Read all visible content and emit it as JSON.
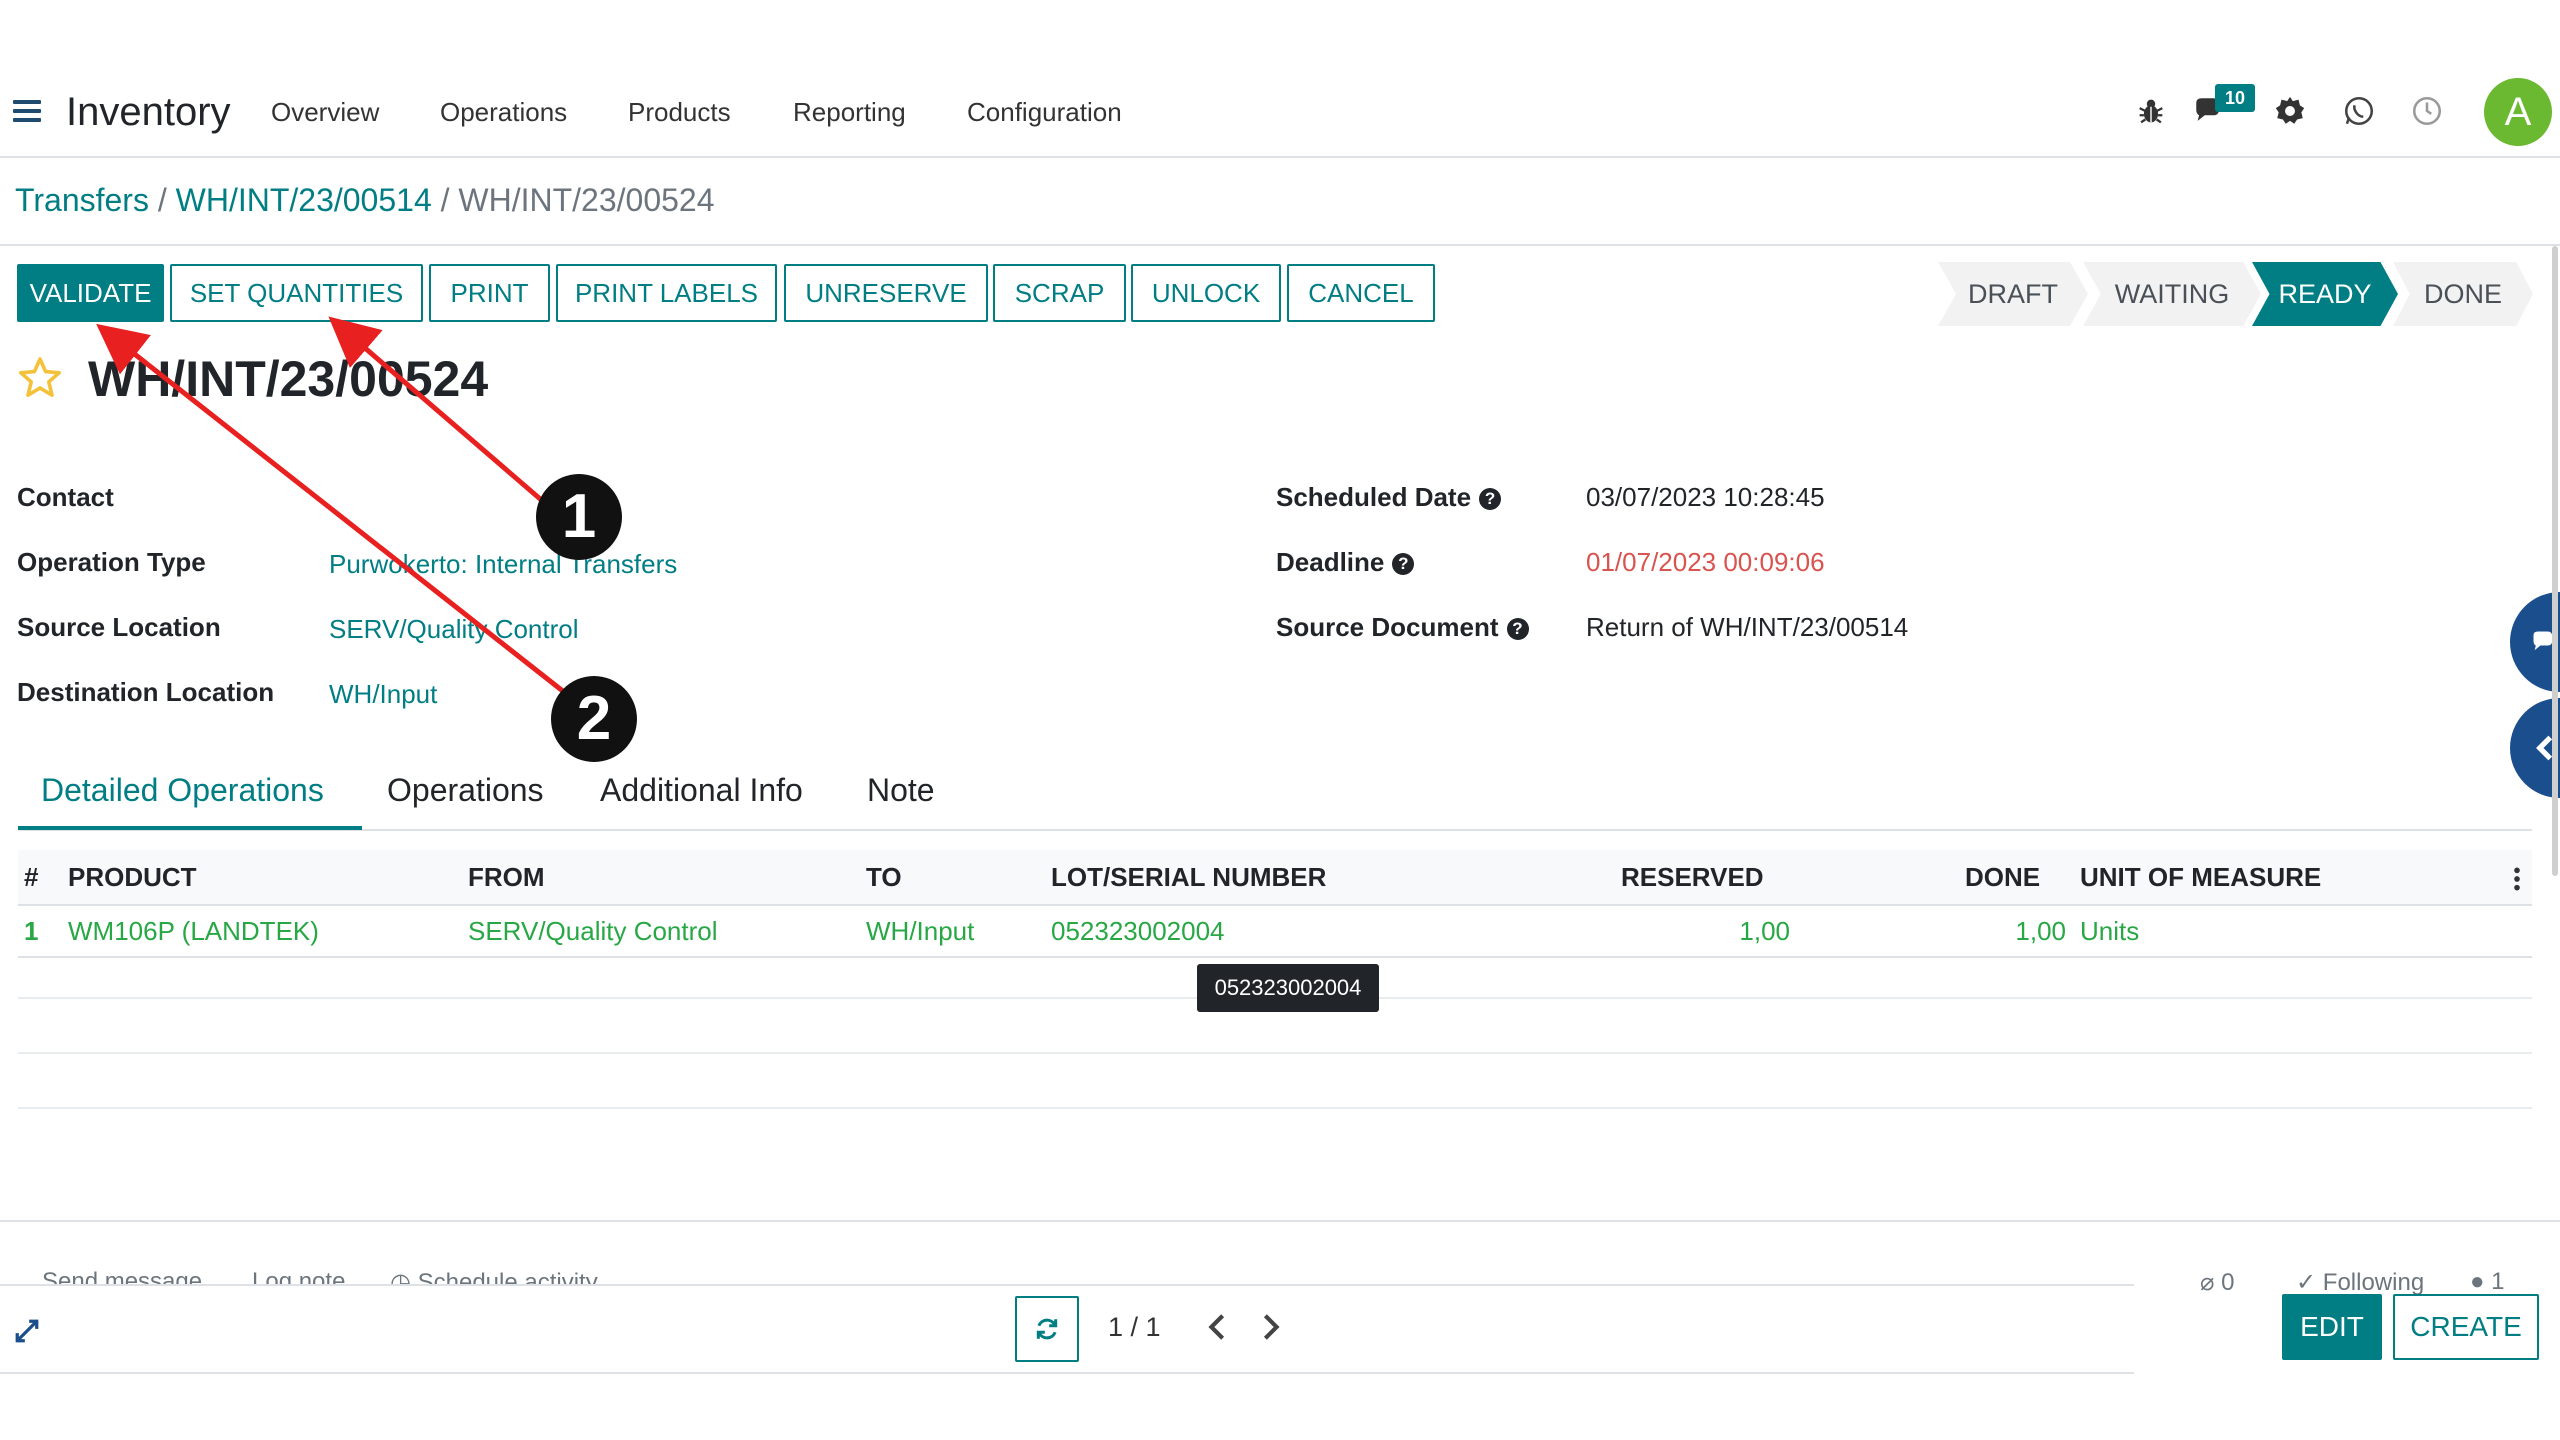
{
  "navbar": {
    "app_name": "Inventory",
    "menu": [
      "Overview",
      "Operations",
      "Products",
      "Reporting",
      "Configuration"
    ],
    "messages_badge": "10",
    "avatar_letter": "A",
    "systray_icons": [
      "bug-icon",
      "chat-icon",
      "gear-icon",
      "whatsapp-icon",
      "clock-icon"
    ]
  },
  "breadcrumb": {
    "parent": "Transfers",
    "middle": "WH/INT/23/00514",
    "current": "WH/INT/23/00524",
    "separator": "/"
  },
  "actions": {
    "validate": "VALIDATE",
    "set_quantities": "SET QUANTITIES",
    "print": "PRINT",
    "print_labels": "PRINT LABELS",
    "unreserve": "UNRESERVE",
    "scrap": "SCRAP",
    "unlock": "UNLOCK",
    "cancel": "CANCEL"
  },
  "status": {
    "stages": [
      "DRAFT",
      "WAITING",
      "READY",
      "DONE"
    ],
    "active": "READY"
  },
  "record": {
    "title": "WH/INT/23/00524"
  },
  "fields": {
    "contact_label": "Contact",
    "contact_value": "",
    "operation_type_label": "Operation Type",
    "operation_type_value": "Purwokerto: Internal Transfers",
    "source_location_label": "Source Location",
    "source_location_value": "SERV/Quality Control",
    "destination_location_label": "Destination Location",
    "destination_location_value": "WH/Input",
    "scheduled_date_label": "Scheduled Date",
    "scheduled_date_value": "03/07/2023 10:28:45",
    "deadline_label": "Deadline",
    "deadline_value": "01/07/2023 00:09:06",
    "source_document_label": "Source Document",
    "source_document_value": "Return of WH/INT/23/00514",
    "help_glyph": "?"
  },
  "tabs": {
    "detailed_operations": "Detailed Operations",
    "operations": "Operations",
    "additional_info": "Additional Info",
    "note": "Note"
  },
  "table": {
    "headers": {
      "index": "#",
      "product": "PRODUCT",
      "from": "FROM",
      "to": "TO",
      "lot": "LOT/SERIAL NUMBER",
      "reserved": "RESERVED",
      "done": "DONE",
      "uom": "UNIT OF MEASURE"
    },
    "rows": [
      {
        "index": "1",
        "product": "WM106P (LANDTEK)",
        "from": "SERV/Quality Control",
        "to": "WH/Input",
        "lot": "052323002004",
        "reserved": "1,00",
        "done": "1,00",
        "uom": "Units"
      }
    ],
    "tooltip": "052323002004"
  },
  "chatter": {
    "send_message": "Send message",
    "log_note": "Log note",
    "schedule_activity": "Schedule activity",
    "attachments": "0",
    "following": "Following",
    "followers": "1"
  },
  "pager": {
    "value": "1 / 1"
  },
  "bottom_buttons": {
    "edit": "EDIT",
    "create": "CREATE"
  },
  "annotations": {
    "marker_1": "1",
    "marker_2": "2",
    "arrow_color": "#e8201f"
  },
  "colors": {
    "brand": "#017e84",
    "avatar": "#6ab931",
    "line_text": "#28a745",
    "deadline": "#d9534f"
  }
}
